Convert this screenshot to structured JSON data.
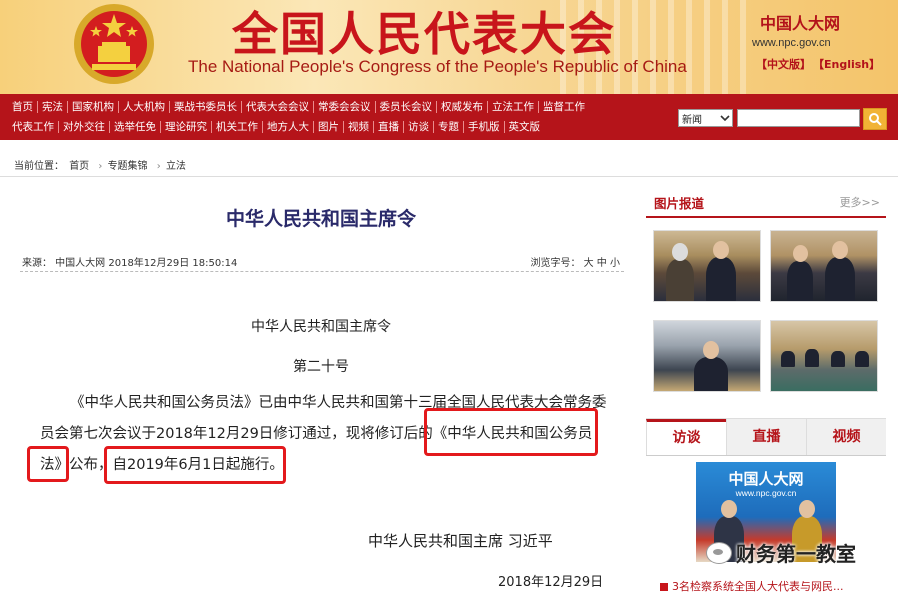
{
  "header": {
    "title_cn": "全国人民代表大会",
    "title_en": "The National People's Congress of the People's Republic of China",
    "logo_text": "中国人大网",
    "url": "www.npc.gov.cn",
    "lang_cn": "【中文版】",
    "lang_en": "【English】"
  },
  "nav": {
    "row1": [
      "首页",
      "宪法",
      "国家机构",
      "人大机构",
      "栗战书委员长",
      "代表大会会议",
      "常委会会议",
      "委员长会议",
      "权威发布",
      "立法工作",
      "监督工作"
    ],
    "row2": [
      "代表工作",
      "对外交往",
      "选举任免",
      "理论研究",
      "机关工作",
      "地方人大",
      "图片",
      "视频",
      "直播",
      "访谈",
      "专题",
      "手机版",
      "英文版"
    ]
  },
  "search": {
    "select_value": "新闻",
    "placeholder": ""
  },
  "breadcrumb": {
    "label": "当前位置：",
    "items": [
      "首页",
      "专题集锦",
      "立法"
    ]
  },
  "article": {
    "title": "中华人民共和国主席令",
    "source": "来源： 中国人大网 2018年12月29日 18:50:14",
    "font_size": "浏览字号： 大 中 小",
    "doc_title": "中华人民共和国主席令",
    "doc_number": "第二十号",
    "paragraph": "《中华人民共和国公务员法》已由中华人民共和国第十三届全国人民代表大会常务委员会第七次会议于2018年12月29日修订通过，现将修订后的《中华人民共和国公务员法》公布，自2019年6月1日起施行。",
    "signature": "中华人民共和国主席 习近平",
    "date": "2018年12月29日"
  },
  "sidebar": {
    "photo_section_title": "图片报道",
    "more": "更多>>",
    "tabs": [
      "访谈",
      "直播",
      "视频"
    ],
    "video_logo": "中国人大网",
    "video_url": "www.npc.gov.cn",
    "link": "3名检察系统全国人大代表与网民..."
  },
  "watermark": "财务第一教室"
}
